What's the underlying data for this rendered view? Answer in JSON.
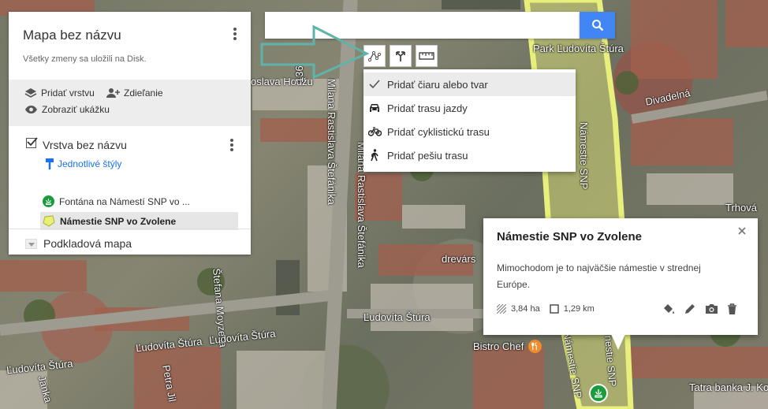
{
  "map_panel": {
    "title": "Mapa bez názvu",
    "save_status": "Všetky zmeny sa uložili na Disk.",
    "actions": {
      "add_layer": "Pridať vrstvu",
      "share": "Zdieľanie",
      "preview": "Zobraziť ukážku"
    },
    "layer": {
      "name": "Vrstva bez názvu",
      "style_link": "Jednotlivé štýly",
      "features": [
        {
          "label": "Fontána na Námestí SNP vo ...",
          "icon": "fountain-marker-icon"
        },
        {
          "label": "Námestie SNP vo Zvolene",
          "icon": "polygon-icon"
        }
      ]
    },
    "base_map": {
      "label": "Podkladová mapa"
    }
  },
  "search": {
    "placeholder": "",
    "value": ""
  },
  "toolbar": {
    "icons": [
      "draw-line-icon",
      "directions-icon",
      "measure-ruler-icon"
    ]
  },
  "draw_menu": {
    "items": [
      {
        "label": "Pridať čiaru alebo tvar",
        "icon": "check-icon",
        "selected": true
      },
      {
        "label": "Pridať trasu jazdy",
        "icon": "car-icon"
      },
      {
        "label": "Pridať cyklistickú trasu",
        "icon": "bicycle-icon"
      },
      {
        "label": "Pridať pešiu trasu",
        "icon": "walking-icon"
      }
    ]
  },
  "info_window": {
    "title": "Námestie SNP vo Zvolene",
    "description": "Mimochodom je to najväčšie námestie v strednej Európe.",
    "area": "3,84 ha",
    "perimeter": "1,29 km"
  },
  "streets": {
    "hodzu": "oslava Hodžu",
    "stefanika_1": "Milana Rastislava Štefánika",
    "stefanika_2": "Milana Rastislava Štefánika",
    "moyzesa": "Štefana Moyzesa",
    "stura_1": "Ľudovíta Štúra",
    "stura_2": "Ľudovíta Štúra",
    "stura_3": "Ľudovíta Štúra",
    "stura_4": "Ľudovíta Štúra",
    "janka": "Janka",
    "petra": "Petra Jil",
    "divadelna": "Divadelná",
    "trhova": "Trhová",
    "park": "Park Ľudovíta Štúra",
    "namestie_snp_1": "Námestie SNP",
    "namestie_snp_2": "Námestie SNP",
    "namestie_snp_3": "nestie SNP",
    "dreva": "drevárs",
    "bistro": "Bistro Chef",
    "tatra": "Tatra banka J. Ko",
    "num_136": "136"
  },
  "colors": {
    "accent_blue": "#4285f4",
    "link_blue": "#1a73e8",
    "polygon_fill": "#e8ef7a",
    "marker_green": "#1a9c3d",
    "arrow_stroke": "#5fb3a8"
  }
}
